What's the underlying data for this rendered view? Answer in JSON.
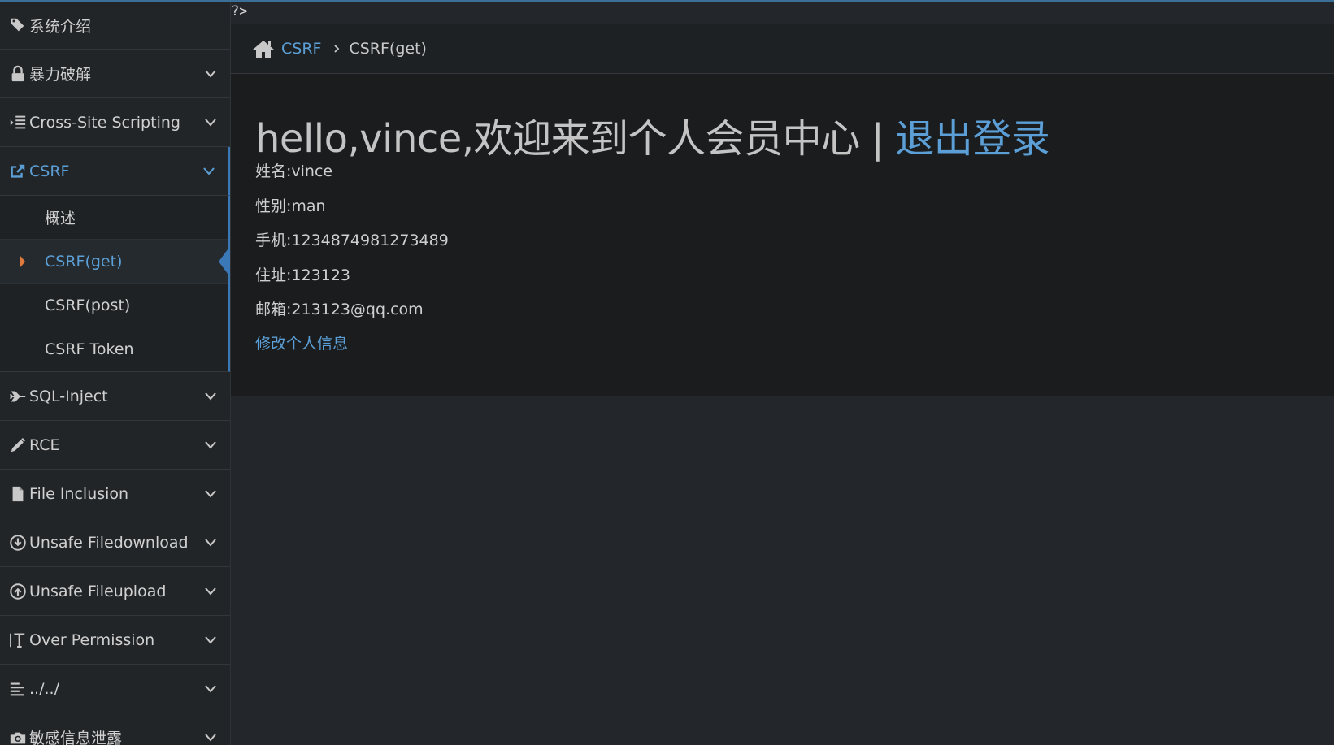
{
  "code_leak": "?>",
  "sidebar": {
    "items": [
      {
        "label": "系统介绍",
        "icon": "tags-icon"
      },
      {
        "label": "暴力破解",
        "icon": "lock-icon"
      },
      {
        "label": "Cross-Site Scripting",
        "icon": "list-indent-icon"
      },
      {
        "label": "CSRF",
        "icon": "share-square-icon"
      },
      {
        "label": "SQL-Inject",
        "icon": "plane-icon"
      },
      {
        "label": "RCE",
        "icon": "pencil-icon"
      },
      {
        "label": "File Inclusion",
        "icon": "file-icon"
      },
      {
        "label": "Unsafe Filedownload",
        "icon": "download-circle-icon"
      },
      {
        "label": "Unsafe Fileupload",
        "icon": "upload-circle-icon"
      },
      {
        "label": "Over Permission",
        "icon": "text-height-icon"
      },
      {
        "label": "../../",
        "icon": "align-left-icon"
      },
      {
        "label": "敏感信息泄露",
        "icon": "camera-icon"
      }
    ],
    "csrf_submenu": [
      "概述",
      "CSRF(get)",
      "CSRF(post)",
      "CSRF Token"
    ]
  },
  "breadcrumb": {
    "section": "CSRF",
    "current": "CSRF(get)"
  },
  "main": {
    "welcome": "hello,vince,欢迎来到个人会员中心",
    "separator": "|",
    "logout": "退出登录",
    "fields": [
      "姓名:vince",
      "性别:man",
      "手机:1234874981273489",
      "住址:123123",
      "邮箱:213123@qq.com"
    ],
    "edit_link": "修改个人信息"
  },
  "colors": {
    "accent": "#5b9fd6",
    "active_border": "#3a78b8",
    "caret": "#e07a3c",
    "page_bg": "#23272b",
    "panel_bg": "#1a1c1e"
  }
}
